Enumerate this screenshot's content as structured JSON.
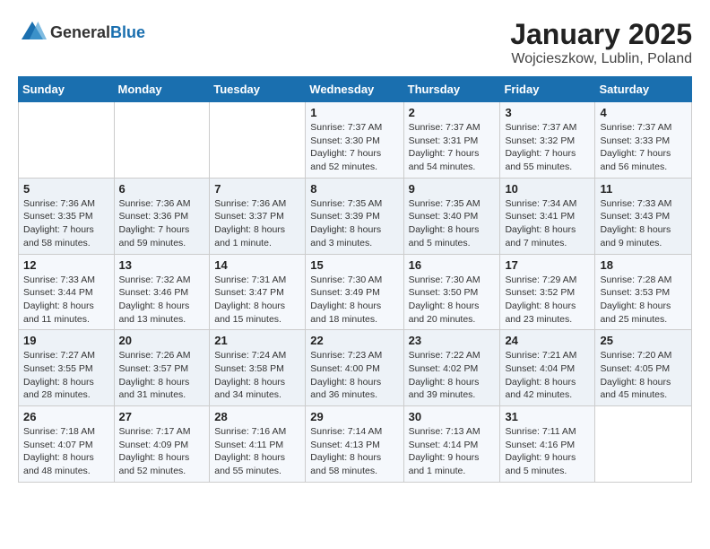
{
  "header": {
    "logo": {
      "general": "General",
      "blue": "Blue"
    },
    "title": "January 2025",
    "subtitle": "Wojcieszkow, Lublin, Poland"
  },
  "weekdays": [
    "Sunday",
    "Monday",
    "Tuesday",
    "Wednesday",
    "Thursday",
    "Friday",
    "Saturday"
  ],
  "weeks": [
    [
      {
        "day": "",
        "info": ""
      },
      {
        "day": "",
        "info": ""
      },
      {
        "day": "",
        "info": ""
      },
      {
        "day": "1",
        "info": "Sunrise: 7:37 AM\nSunset: 3:30 PM\nDaylight: 7 hours and 52 minutes."
      },
      {
        "day": "2",
        "info": "Sunrise: 7:37 AM\nSunset: 3:31 PM\nDaylight: 7 hours and 54 minutes."
      },
      {
        "day": "3",
        "info": "Sunrise: 7:37 AM\nSunset: 3:32 PM\nDaylight: 7 hours and 55 minutes."
      },
      {
        "day": "4",
        "info": "Sunrise: 7:37 AM\nSunset: 3:33 PM\nDaylight: 7 hours and 56 minutes."
      }
    ],
    [
      {
        "day": "5",
        "info": "Sunrise: 7:36 AM\nSunset: 3:35 PM\nDaylight: 7 hours and 58 minutes."
      },
      {
        "day": "6",
        "info": "Sunrise: 7:36 AM\nSunset: 3:36 PM\nDaylight: 7 hours and 59 minutes."
      },
      {
        "day": "7",
        "info": "Sunrise: 7:36 AM\nSunset: 3:37 PM\nDaylight: 8 hours and 1 minute."
      },
      {
        "day": "8",
        "info": "Sunrise: 7:35 AM\nSunset: 3:39 PM\nDaylight: 8 hours and 3 minutes."
      },
      {
        "day": "9",
        "info": "Sunrise: 7:35 AM\nSunset: 3:40 PM\nDaylight: 8 hours and 5 minutes."
      },
      {
        "day": "10",
        "info": "Sunrise: 7:34 AM\nSunset: 3:41 PM\nDaylight: 8 hours and 7 minutes."
      },
      {
        "day": "11",
        "info": "Sunrise: 7:33 AM\nSunset: 3:43 PM\nDaylight: 8 hours and 9 minutes."
      }
    ],
    [
      {
        "day": "12",
        "info": "Sunrise: 7:33 AM\nSunset: 3:44 PM\nDaylight: 8 hours and 11 minutes."
      },
      {
        "day": "13",
        "info": "Sunrise: 7:32 AM\nSunset: 3:46 PM\nDaylight: 8 hours and 13 minutes."
      },
      {
        "day": "14",
        "info": "Sunrise: 7:31 AM\nSunset: 3:47 PM\nDaylight: 8 hours and 15 minutes."
      },
      {
        "day": "15",
        "info": "Sunrise: 7:30 AM\nSunset: 3:49 PM\nDaylight: 8 hours and 18 minutes."
      },
      {
        "day": "16",
        "info": "Sunrise: 7:30 AM\nSunset: 3:50 PM\nDaylight: 8 hours and 20 minutes."
      },
      {
        "day": "17",
        "info": "Sunrise: 7:29 AM\nSunset: 3:52 PM\nDaylight: 8 hours and 23 minutes."
      },
      {
        "day": "18",
        "info": "Sunrise: 7:28 AM\nSunset: 3:53 PM\nDaylight: 8 hours and 25 minutes."
      }
    ],
    [
      {
        "day": "19",
        "info": "Sunrise: 7:27 AM\nSunset: 3:55 PM\nDaylight: 8 hours and 28 minutes."
      },
      {
        "day": "20",
        "info": "Sunrise: 7:26 AM\nSunset: 3:57 PM\nDaylight: 8 hours and 31 minutes."
      },
      {
        "day": "21",
        "info": "Sunrise: 7:24 AM\nSunset: 3:58 PM\nDaylight: 8 hours and 34 minutes."
      },
      {
        "day": "22",
        "info": "Sunrise: 7:23 AM\nSunset: 4:00 PM\nDaylight: 8 hours and 36 minutes."
      },
      {
        "day": "23",
        "info": "Sunrise: 7:22 AM\nSunset: 4:02 PM\nDaylight: 8 hours and 39 minutes."
      },
      {
        "day": "24",
        "info": "Sunrise: 7:21 AM\nSunset: 4:04 PM\nDaylight: 8 hours and 42 minutes."
      },
      {
        "day": "25",
        "info": "Sunrise: 7:20 AM\nSunset: 4:05 PM\nDaylight: 8 hours and 45 minutes."
      }
    ],
    [
      {
        "day": "26",
        "info": "Sunrise: 7:18 AM\nSunset: 4:07 PM\nDaylight: 8 hours and 48 minutes."
      },
      {
        "day": "27",
        "info": "Sunrise: 7:17 AM\nSunset: 4:09 PM\nDaylight: 8 hours and 52 minutes."
      },
      {
        "day": "28",
        "info": "Sunrise: 7:16 AM\nSunset: 4:11 PM\nDaylight: 8 hours and 55 minutes."
      },
      {
        "day": "29",
        "info": "Sunrise: 7:14 AM\nSunset: 4:13 PM\nDaylight: 8 hours and 58 minutes."
      },
      {
        "day": "30",
        "info": "Sunrise: 7:13 AM\nSunset: 4:14 PM\nDaylight: 9 hours and 1 minute."
      },
      {
        "day": "31",
        "info": "Sunrise: 7:11 AM\nSunset: 4:16 PM\nDaylight: 9 hours and 5 minutes."
      },
      {
        "day": "",
        "info": ""
      }
    ]
  ]
}
